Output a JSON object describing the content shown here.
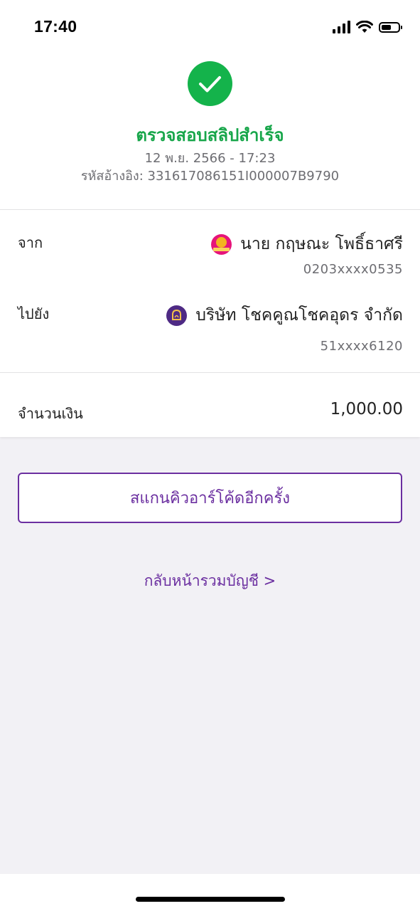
{
  "status_bar": {
    "time": "17:40",
    "icons": [
      "cellular-signal-icon",
      "wifi-icon",
      "battery-icon"
    ],
    "battery_level": 0.6
  },
  "header": {
    "icon": "checkmark-circle-icon",
    "title": "ตรวจสอบสลิปสำเร็จ",
    "datetime": "12 พ.ย. 2566 - 17:23",
    "reference": "รหัสอ้างอิง: 331617086151I000007B9790"
  },
  "transfer": {
    "from": {
      "label": "จาก",
      "name": "นาย กฤษณะ โพธิ์ธาศรี",
      "account": "0203xxxx0535",
      "bank_icon": "gsb-bank-logo-icon"
    },
    "to": {
      "label": "ไปยัง",
      "name": "บริษัท โชคคูณโชคอุดร จำกัด",
      "account": "51xxxx6120",
      "bank_icon": "scb-bank-logo-icon"
    }
  },
  "amount": {
    "label": "จำนวนเงิน",
    "value": "1,000.00"
  },
  "actions": {
    "scan_again_label": "สแกนคิวอาร์โค้ดอีกครั้ง",
    "back_to_accounts_label": "กลับหน้ารวมบัญชี >"
  },
  "colors": {
    "success_green": "#14b34b",
    "title_green": "#17a64a",
    "accent_purple": "#6b2fa0",
    "background": "#f2f1f5"
  }
}
